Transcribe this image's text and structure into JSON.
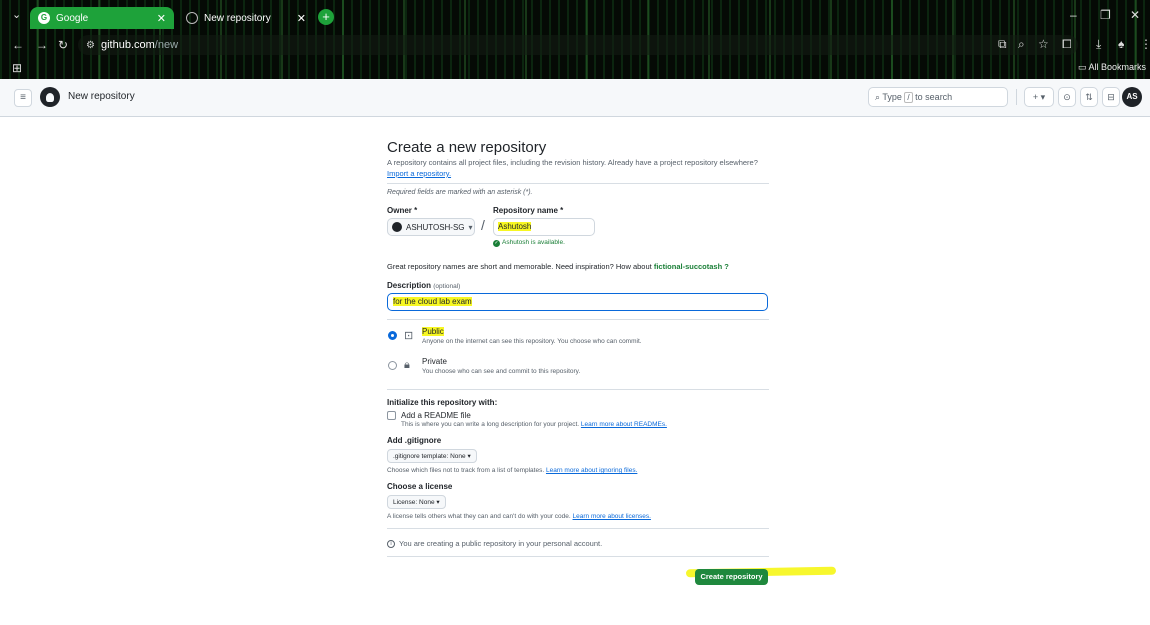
{
  "browser": {
    "tabs": [
      {
        "title": "Google",
        "active": true
      },
      {
        "title": "New repository",
        "active": false
      }
    ],
    "url_host": "github.com",
    "url_path": "/new",
    "bookmarks_label": "All Bookmarks"
  },
  "header": {
    "title": "New repository",
    "search_placeholder_prefix": "Type",
    "search_key": "/",
    "search_placeholder_suffix": "to search",
    "avatar_initials": "AS"
  },
  "form": {
    "heading": "Create a new repository",
    "subtitle": "A repository contains all project files, including the revision history. Already have a project repository elsewhere?",
    "import_link": "Import a repository.",
    "required_note": "Required fields are marked with an asterisk (*).",
    "owner_label": "Owner *",
    "owner_value": "ASHUTOSH-SG",
    "repo_label": "Repository name *",
    "repo_value": "Ashutosh",
    "available_msg": "Ashutosh is available.",
    "great_text": "Great repository names are short and memorable. Need inspiration? How about",
    "suggestion": "fictional-succotash",
    "suggestion_suffix": "?",
    "description_label": "Description",
    "description_optional": "(optional)",
    "description_value": "for the cloud lab exam",
    "public_title": "Public",
    "public_desc": "Anyone on the internet can see this repository. You choose who can commit.",
    "private_title": "Private",
    "private_desc": "You choose who can see and commit to this repository.",
    "init_label": "Initialize this repository with:",
    "readme_label": "Add a README file",
    "readme_desc": "This is where you can write a long description for your project.",
    "readme_link": "Learn more about READMEs.",
    "gitignore_label": "Add .gitignore",
    "gitignore_dd": ".gitignore template: None",
    "gitignore_desc": "Choose which files not to track from a list of templates.",
    "gitignore_link": "Learn more about ignoring files.",
    "license_label": "Choose a license",
    "license_dd": "License: None",
    "license_desc": "A license tells others what they can and can't do with your code.",
    "license_link": "Learn more about licenses.",
    "info_msg": "You are creating a public repository in your personal account.",
    "create_button": "Create repository"
  },
  "colors": {
    "primary_button": "#1f883d",
    "highlight": "#f7f722",
    "link": "#0969da",
    "tab_active": "#1ea23a"
  }
}
